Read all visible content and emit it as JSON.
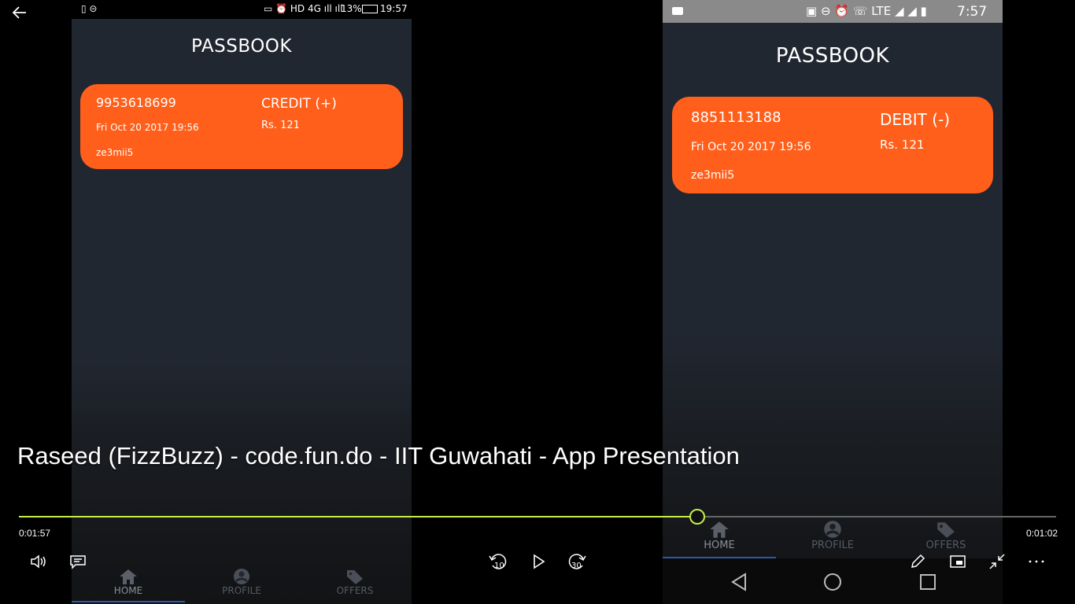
{
  "left_phone": {
    "status_bar": {
      "battery": "13%",
      "time": "19:57"
    },
    "title": "PASSBOOK",
    "card": {
      "phone_number": "9953618699",
      "datetime": "Fri Oct 20 2017 19:56",
      "code": "ze3mii5",
      "type": "CREDIT (+)",
      "amount": "Rs. 121"
    },
    "nav": [
      {
        "label": "HOME",
        "icon": "home-icon"
      },
      {
        "label": "PROFILE",
        "icon": "profile-icon"
      },
      {
        "label": "OFFERS",
        "icon": "tag-icon"
      }
    ]
  },
  "right_phone": {
    "status_bar": {
      "time": "7:57"
    },
    "title": "PASSBOOK",
    "card": {
      "phone_number": "8851113188",
      "datetime": "Fri Oct 20 2017 19:56",
      "code": "ze3mii5",
      "type": "DEBIT (-)",
      "amount": "Rs. 121"
    },
    "nav": [
      {
        "label": "HOME",
        "icon": "home-icon"
      },
      {
        "label": "PROFILE",
        "icon": "profile-icon"
      },
      {
        "label": "OFFERS",
        "icon": "tag-icon"
      }
    ]
  },
  "player": {
    "video_title": "Raseed (FizzBuzz) - code.fun.do - IIT Guwahati - App Presentation",
    "elapsed": "0:01:57",
    "remaining": "0:01:02",
    "progress": 0.653,
    "skip_back": "10",
    "skip_forward": "30",
    "accent_color": "#c6f04a"
  },
  "colors": {
    "card": "#ff5f1a",
    "phone_bg": "#212731"
  }
}
